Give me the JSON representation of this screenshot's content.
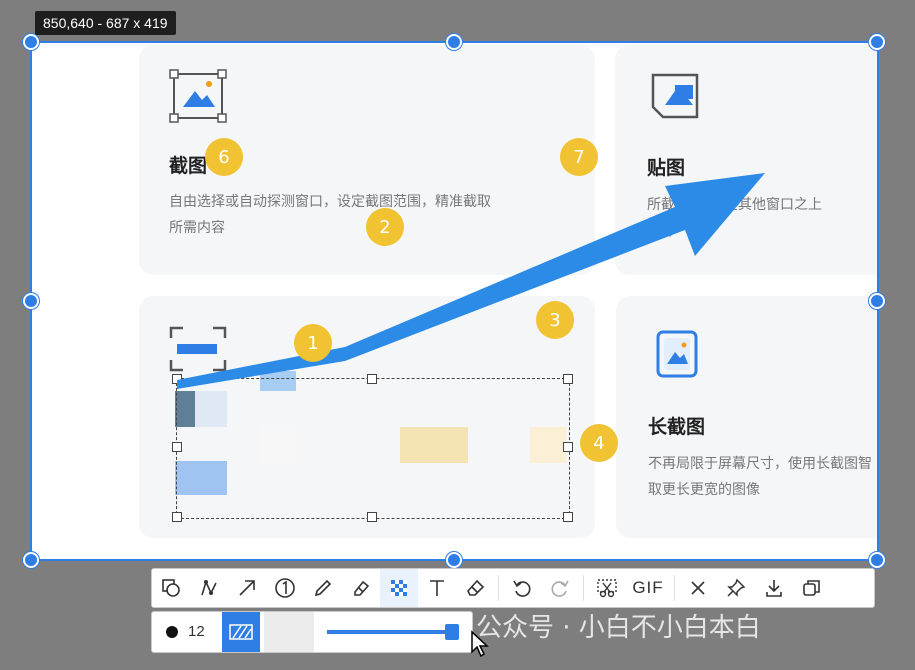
{
  "size_label": "850,640 - 687 x 419",
  "cards": {
    "screenshot": {
      "title": "截图",
      "desc1": "自由选择或自动探测窗口，设定截图范围，精准截取",
      "desc2": "所需内容"
    },
    "pin": {
      "title": "贴图",
      "desc1": "所截...像“贴”在其他窗口之上",
      "desc2": "...阅"
    },
    "long": {
      "title": "长截图",
      "desc1": "不再局限于屏幕尺寸，使用长截图智",
      "desc2": "取更长更宽的图像"
    }
  },
  "markers": [
    "1",
    "2",
    "3",
    "4",
    "6",
    "7"
  ],
  "toolbar": {
    "tools": [
      "shape-icon",
      "polyline-icon",
      "arrow-icon",
      "number-icon",
      "pencil-icon",
      "highlighter-icon",
      "mosaic-icon",
      "text-icon",
      "eraser-icon",
      "undo-icon",
      "redo-icon",
      "scissors-icon",
      "gif-icon",
      "close-icon",
      "pin-icon",
      "download-icon",
      "copy-icon"
    ],
    "gif_label": "GIF",
    "active_tool": "mosaic-icon"
  },
  "sub_toolbar": {
    "brush_size": "12",
    "slider_level": 0.95
  },
  "watermark": "公众号 · 小白不小白本白",
  "colors": {
    "accent": "#2f7ee6",
    "marker": "#f1c232",
    "arrow": "#2b8be6"
  }
}
